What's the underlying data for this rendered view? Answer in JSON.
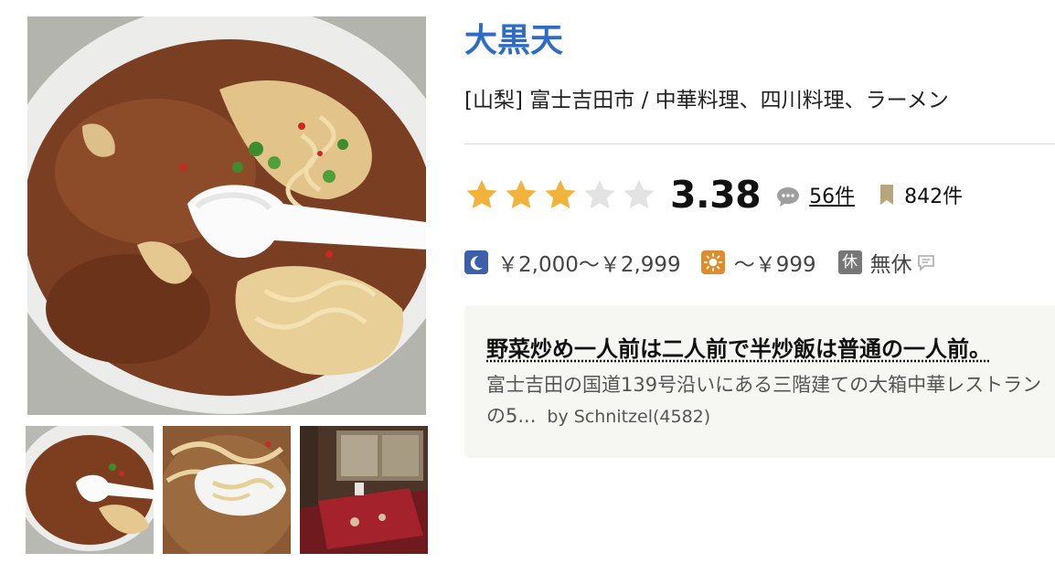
{
  "shop": {
    "name": "大黒天",
    "area_genre": "[山梨] 富士吉田市 / 中華料理、四川料理、ラーメン"
  },
  "rating": {
    "stars": 3,
    "max_stars": 5,
    "score": "3.38",
    "review_count": "56件",
    "bookmark_count": "842件"
  },
  "budget": {
    "dinner": "￥2,000～￥2,999",
    "lunch": "～￥999",
    "holiday_badge": "休",
    "holiday": "無休"
  },
  "review": {
    "title": "野菜炒め一人前は二人前で半炒飯は普通の一人前。",
    "body_line1": "富士吉田の国道139号沿いにある三階建ての大箱中華レストラン",
    "body_line2": "の5...",
    "author": "by Schnitzel(4582)"
  },
  "icons": {
    "star": "star-icon",
    "review": "speech-bubble-icon",
    "bookmark": "bookmark-icon",
    "dinner": "moon-icon",
    "lunch": "sun-icon",
    "note": "comment-note-icon"
  },
  "colors": {
    "shop_name": "#2b6cc4",
    "star_on": "#f2b33d",
    "star_off": "#e3e3e3",
    "dinner_icon": "#3b5fa8",
    "lunch_icon": "#de8d2e",
    "review_box": "#f6f6f3"
  }
}
